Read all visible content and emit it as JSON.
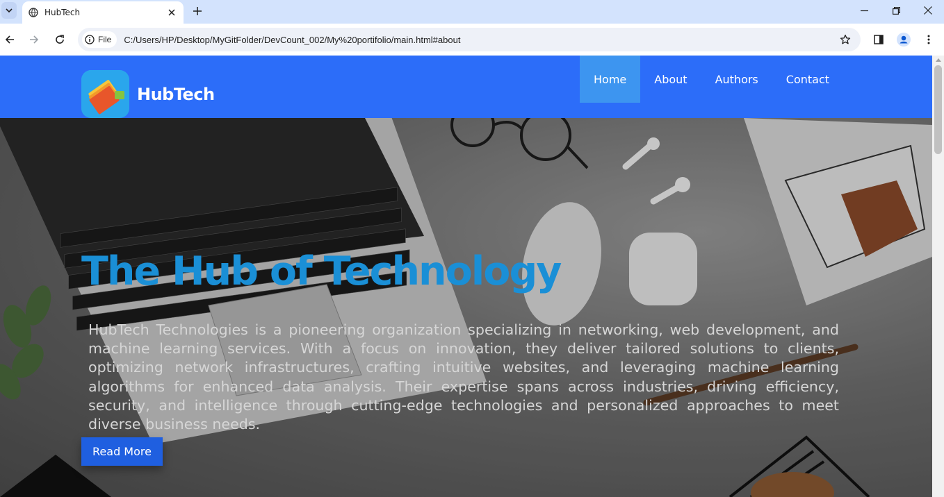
{
  "browser": {
    "tab_title": "HubTech",
    "file_chip": "File",
    "url": "C:/Users/HP/Desktop/MyGitFolder/DevCount_002/My%20portifolio/main.html#about"
  },
  "site": {
    "brand": "HubTech",
    "nav": [
      "Home",
      "About",
      "Authors",
      "Contact"
    ],
    "active_nav": "Home",
    "colors": {
      "header": "#2c6df9",
      "active_nav": "#3d95f0",
      "title": "#1a8fd6",
      "button": "#1f5fe0"
    }
  },
  "hero": {
    "title": "The Hub of Technology",
    "text": "HubTech Technologies is a pioneering organization specializing in networking, web development, and machine learning services. With a focus on innovation, they deliver tailored solutions to clients, optimizing network infrastructures, crafting intuitive websites, and leveraging machine learning algorithms for enhanced data analysis. Their expertise spans across industries, driving efficiency, security, and intelligence through cutting-edge technologies and personalized approaches to meet diverse business needs.",
    "button": "Read More"
  }
}
